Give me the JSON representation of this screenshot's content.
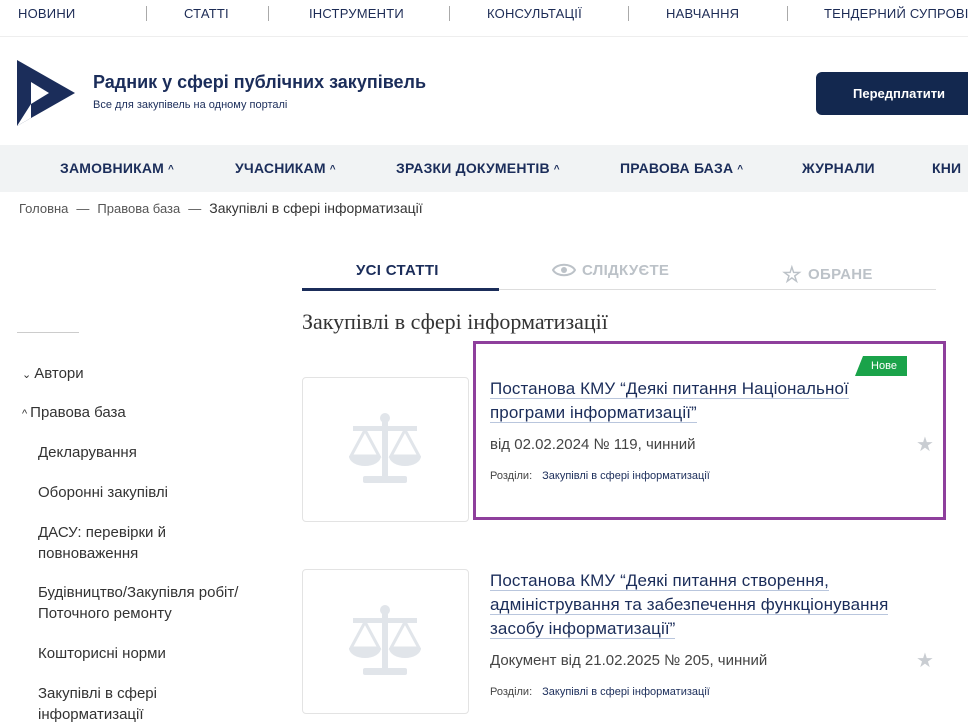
{
  "topnav": {
    "items": [
      "НОВИНИ",
      "СТАТТІ",
      "ІНСТРУМЕНТИ",
      "КОНСУЛЬТАЦІЇ",
      "НАВЧАННЯ",
      "ТЕНДЕРНИЙ СУПРОВІ"
    ]
  },
  "header": {
    "title": "Радник у сфері публічних закупівель",
    "subtitle": "Все для закупівель на одному порталі",
    "subscribe_label": "Передплатити"
  },
  "mainmenu": {
    "items": [
      "ЗАМОВНИКАМ",
      "УЧАСНИКАМ",
      "ЗРАЗКИ ДОКУМЕНТІВ",
      "ПРАВОВА БАЗА",
      "ЖУРНАЛИ",
      "КНИ"
    ]
  },
  "breadcrumbs": {
    "home": "Головна",
    "section": "Правова база",
    "current": "Закупівлі в сфері інформатизації"
  },
  "tabs": {
    "all": "УСІ СТАТТІ",
    "following": "СЛІДКУЄТЕ",
    "favorites": "ОБРАНЕ"
  },
  "sidebar": {
    "authors": "Автори",
    "legal_base": "Правова база",
    "items": [
      "Декларування",
      "Оборонні закупівлі",
      "ДАСУ: перевірки й повноваження",
      "Будівництво/Закупівля робіт/ Поточного ремонту",
      "Кошторисні норми",
      "Закупівлі в сфері інформатизації"
    ]
  },
  "page_heading": "Закупівлі в сфері інформатизації",
  "cards": [
    {
      "badge": "Нове",
      "title": "Постанова КМУ “Деякі питання Національної програми інформатизації”",
      "meta": "від 02.02.2024 № 119, чинний",
      "sections_label": "Розділи:",
      "section_link": "Закупівлі в сфері інформатизації"
    },
    {
      "title": "Постанова КМУ “Деякі питання створення, адміністрування та забезпечення функціонування засобу інформатизації”",
      "meta": "Документ від 21.02.2025 № 205, чинний",
      "sections_label": "Розділи:",
      "section_link": "Закупівлі в сфері інформатизації"
    }
  ],
  "colors": {
    "brand": "#1b2d5a",
    "badge": "#1aa34a",
    "highlight": "#8e3f9c"
  }
}
